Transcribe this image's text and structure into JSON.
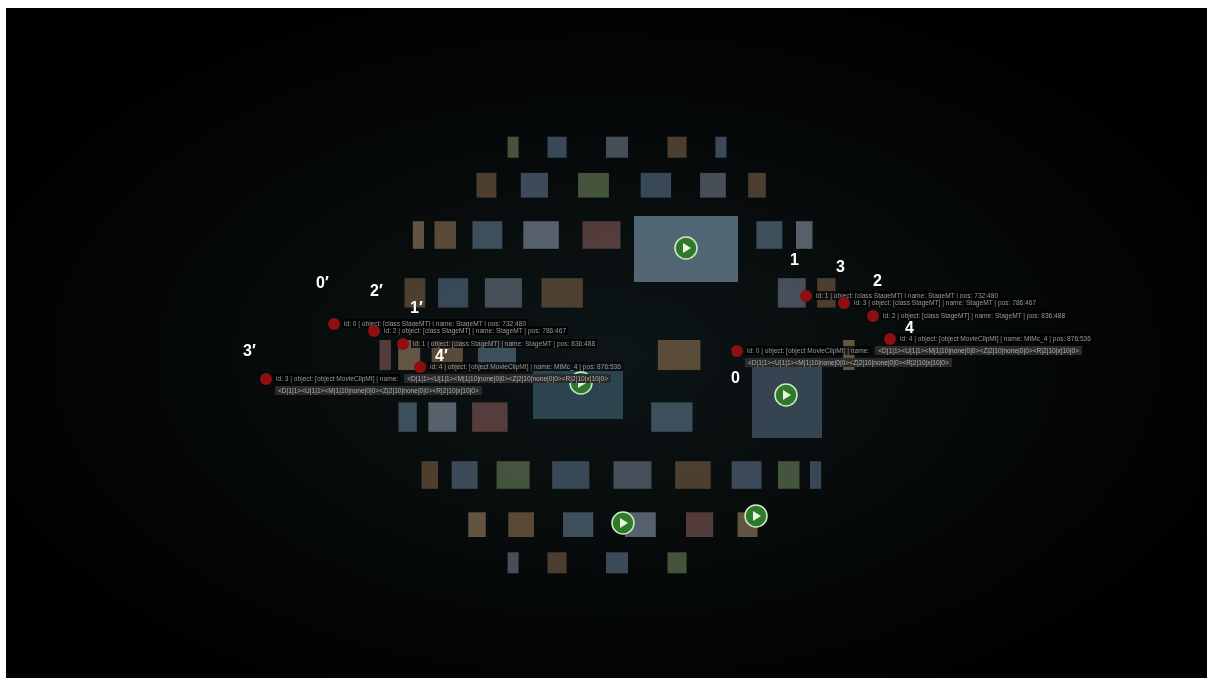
{
  "left_group": {
    "markers": [
      {
        "number": "0′",
        "info": "id: 0 | object: [class StageMT] | name: StageMT | pos: 732:480"
      },
      {
        "number": "2′",
        "info": "id: 2 | object: [class StageMT] | name: StageMT | pos: 786:467"
      },
      {
        "number": "1′",
        "info": "id: 1 | object: [class StageMT] | name: StageMT | pos: 836:488"
      },
      {
        "number": "4′",
        "info": "id: 4 | object: [object MovieClipMt] | name: MtMc_4 | pos: 876:536"
      },
      {
        "number": "3′",
        "info": "id: 3 | object: [object MovieClipMt] | name:",
        "codes": [
          "<D|1|1><U|1|1><M|1|10|none|0|0><Z|2|10|none|0|0><R|2|10|x|10|0>",
          "<D|1|1><U|1|1><M|1|10|none|0|0><Z|2|10|none|0|0><R|2|10|x|10|0>"
        ]
      }
    ]
  },
  "right_group": {
    "markers": [
      {
        "number": "1",
        "info": "id: 1 | object: [class StageMT] | name: StageMT | pos: 732:480"
      },
      {
        "number": "3",
        "info": "id: 3 | object: [class StageMT] | name: StageMT | pos: 786:467"
      },
      {
        "number": "2",
        "info": "id: 2 | object: [class StageMT] | name: StageMT | pos: 836:488"
      },
      {
        "number": "4",
        "info": "id: 4 | object: [object MovieClipMt] | name: MtMc_4 | pos: 876:536"
      },
      {
        "number": "0",
        "info": "id: 0 | object: [object MovieClipMt] | name:",
        "codes": [
          "<D|1|1><U|1|1><M|1|10|none|0|0><Z|2|10|none|0|0><R|2|10|x|10|0>",
          "<D|1|1><U|1|1><M|1|10|none|0|0><Z|2|10|none|0|0><R|2|10|x|10|0>"
        ]
      }
    ]
  }
}
